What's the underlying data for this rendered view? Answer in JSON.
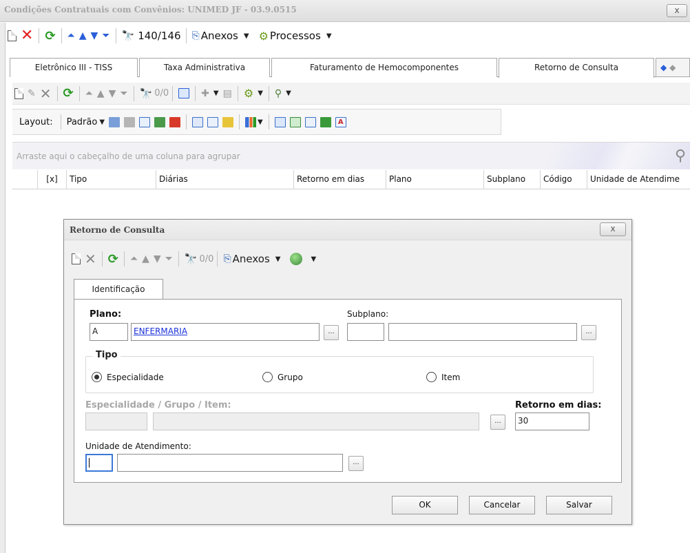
{
  "window": {
    "title": "Condições Contratuais com Convênios: UNIMED JF - 03.9.0515",
    "close_label": "x"
  },
  "main_toolbar": {
    "record_position": "140/146",
    "anexos_label": "Anexos",
    "processos_label": "Processos"
  },
  "tabs": [
    {
      "label": "Eletrônico III - TISS"
    },
    {
      "label": "Taxa Administrativa"
    },
    {
      "label": "Faturamento de Hemocomponentes"
    },
    {
      "label": "Retorno de Consulta",
      "active": true
    }
  ],
  "grid_toolbar": {
    "record_position": "0/0"
  },
  "layout_toolbar": {
    "layout_label": "Layout:",
    "layout_value": "Padrão"
  },
  "group_bar": {
    "placeholder": "Arraste aqui o cabeçalho de uma coluna para agrupar"
  },
  "grid": {
    "columns": [
      "[x]",
      "Tipo",
      "Diárias",
      "Retorno em dias",
      "Plano",
      "Subplano",
      "Código",
      "Unidade de Atendime"
    ]
  },
  "dialog": {
    "title": "Retorno de Consulta",
    "close_label": "x",
    "toolbar": {
      "record_position": "0/0",
      "anexos_label": "Anexos"
    },
    "tab_label": "Identificação",
    "plano_label": "Plano:",
    "plano_code": "A",
    "plano_name": "ENFERMARIA",
    "subplano_label": "Subplano:",
    "subplano_code": "",
    "subplano_name": "",
    "tipo_label": "Tipo",
    "tipo_options": [
      {
        "label": "Especialidade",
        "selected": true
      },
      {
        "label": "Grupo",
        "selected": false
      },
      {
        "label": "Item",
        "selected": false
      }
    ],
    "especialidade_label": "Especialidade / Grupo / Item:",
    "retorno_label": "Retorno em dias:",
    "retorno_value": "30",
    "unidade_label": "Unidade de Atendimento:",
    "lookup_label": "...",
    "buttons": {
      "ok": "OK",
      "cancel": "Cancelar",
      "save": "Salvar"
    }
  },
  "colors": {
    "accent_blue": "#2a5fd8",
    "delete_red": "#e02020",
    "refresh_green": "#2a9a25",
    "link_blue": "#1a32d8"
  }
}
